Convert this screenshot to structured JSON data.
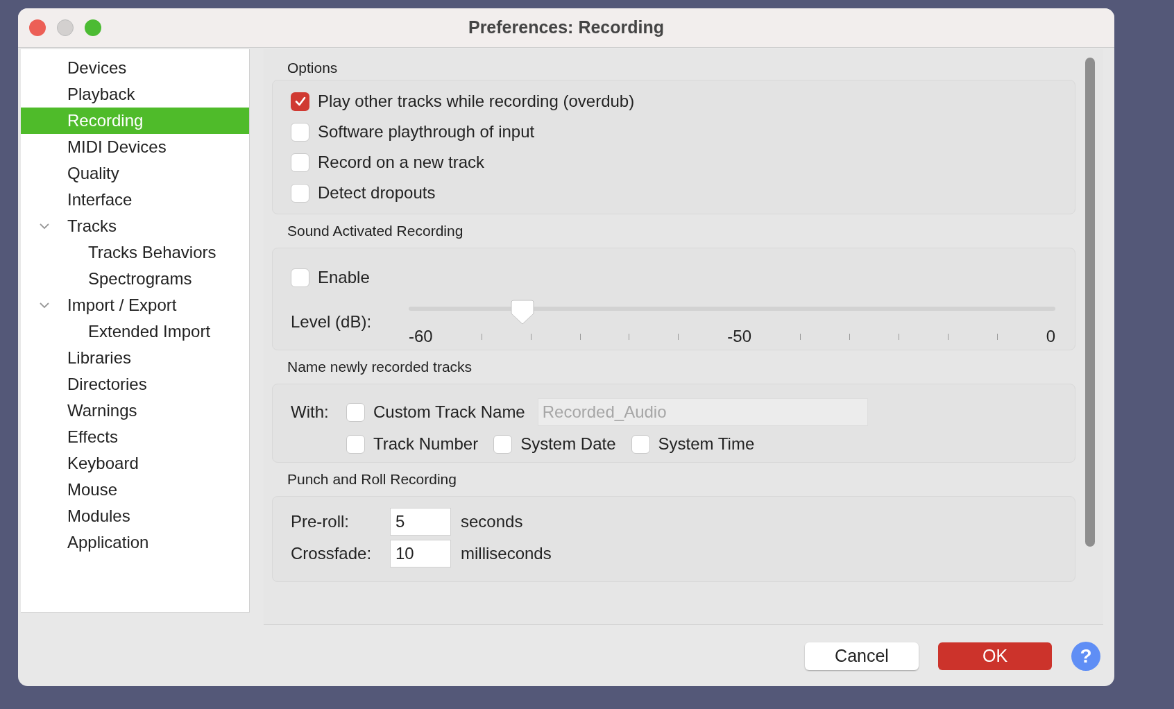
{
  "window": {
    "title": "Preferences: Recording"
  },
  "sidebar": {
    "items": [
      {
        "label": "Devices",
        "selected": false
      },
      {
        "label": "Playback",
        "selected": false
      },
      {
        "label": "Recording",
        "selected": true
      },
      {
        "label": "MIDI Devices",
        "selected": false
      },
      {
        "label": "Quality",
        "selected": false
      },
      {
        "label": "Interface",
        "selected": false
      },
      {
        "label": "Tracks",
        "selected": false,
        "expanded": true,
        "children": [
          {
            "label": "Tracks Behaviors",
            "selected": false
          },
          {
            "label": "Spectrograms",
            "selected": false
          }
        ]
      },
      {
        "label": "Import / Export",
        "selected": false,
        "expanded": true,
        "children": [
          {
            "label": "Extended Import",
            "selected": false
          }
        ]
      },
      {
        "label": "Libraries",
        "selected": false
      },
      {
        "label": "Directories",
        "selected": false
      },
      {
        "label": "Warnings",
        "selected": false
      },
      {
        "label": "Effects",
        "selected": false
      },
      {
        "label": "Keyboard",
        "selected": false
      },
      {
        "label": "Mouse",
        "selected": false
      },
      {
        "label": "Modules",
        "selected": false
      },
      {
        "label": "Application",
        "selected": false
      }
    ]
  },
  "options": {
    "heading": "Options",
    "checkboxes": [
      {
        "label": "Play other tracks while recording (overdub)",
        "checked": true
      },
      {
        "label": "Software playthrough of input",
        "checked": false
      },
      {
        "label": "Record on a new track",
        "checked": false
      },
      {
        "label": "Detect dropouts",
        "checked": false
      }
    ]
  },
  "sound_activated": {
    "heading": "Sound Activated Recording",
    "enable": {
      "label": "Enable",
      "checked": false
    },
    "level_label": "Level (dB):",
    "level": 0.176,
    "scale_labels": [
      "-60",
      "-50",
      "0"
    ]
  },
  "naming": {
    "heading": "Name newly recorded tracks",
    "with_label": "With:",
    "custom_name": {
      "label": "Custom Track Name",
      "checked": false
    },
    "name_field": {
      "value": "Recorded_Audio",
      "disabled": true
    },
    "others": [
      {
        "label": "Track Number",
        "checked": false
      },
      {
        "label": "System Date",
        "checked": false
      },
      {
        "label": "System Time",
        "checked": false
      }
    ]
  },
  "punch": {
    "heading": "Punch and Roll Recording",
    "rows": [
      {
        "label": "Pre-roll:",
        "value": "5",
        "unit": "seconds"
      },
      {
        "label": "Crossfade:",
        "value": "10",
        "unit": "milliseconds"
      }
    ]
  },
  "buttons": [
    {
      "label": "Cancel",
      "kind": "secondary"
    },
    {
      "label": "OK",
      "kind": "primary"
    }
  ],
  "help_button": "?"
}
